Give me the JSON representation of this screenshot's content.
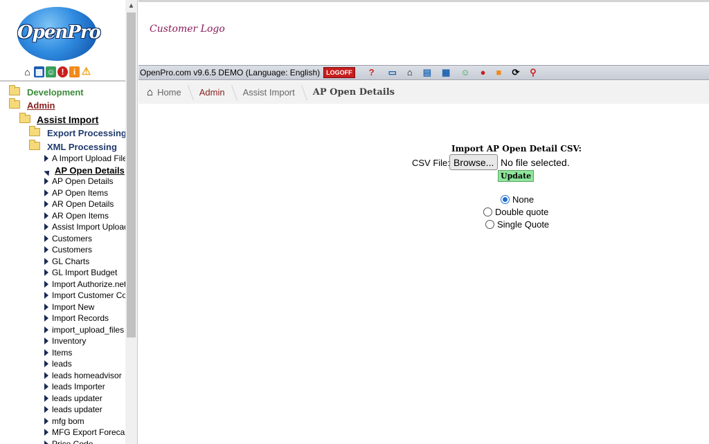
{
  "logo": {
    "text": "OpenPro"
  },
  "left_icons": [
    "home-icon",
    "calculator-icon",
    "people-icon",
    "alert-icon",
    "info-icon",
    "warning-icon"
  ],
  "tree": {
    "development": "Development",
    "admin": "Admin",
    "assist_import": "Assist Import",
    "export_processing": "Export Processing",
    "xml_processing": "XML Processing",
    "items": [
      "A Import Upload Files",
      "AP Open Details",
      "AP Open Details",
      "AP Open Items",
      "AR Open Details",
      "AR Open Items",
      "Assist Import Upload",
      "Customers",
      "Customers",
      "GL Charts",
      "GL Import Budget",
      "Import Authorize.net",
      "Import Customer Co",
      "Import New",
      "Import Records",
      "import_upload_files",
      "Inventory",
      "Items",
      "leads",
      "leads homeadvisor",
      "leads Importer",
      "leads updater",
      "leads updater",
      "mfg bom",
      "MFG Export Forecast",
      "Price Code"
    ]
  },
  "header": {
    "customer_logo": "Customer Logo",
    "version": "OpenPro.com v9.6.5  DEMO  (Language: English)",
    "logoff": "LOGOFF"
  },
  "toolbar_icons": [
    "help-icon",
    "card-icon",
    "home-icon",
    "printer-icon",
    "calculator-icon",
    "people-icon",
    "alert-icon",
    "info-icon",
    "refresh-icon",
    "search-icon"
  ],
  "breadcrumb": {
    "home": "Home",
    "admin": "Admin",
    "assist_import": "Assist Import",
    "current": "AP Open Details"
  },
  "form": {
    "title": "Import AP Open Detail CSV:",
    "csv_label": "CSV File:",
    "browse": "Browse...",
    "no_file": "No file selected.",
    "update": "Update",
    "options": [
      "None",
      "Double quote",
      "Single Quote"
    ],
    "selected": "None"
  },
  "colors": {
    "toolbar_bg": "#c8ccd5",
    "update_bg": "#8ee59a",
    "link_admin": "#8a2020",
    "tree_dev": "#3a8a3a",
    "tree_blue": "#1f3a6e"
  }
}
